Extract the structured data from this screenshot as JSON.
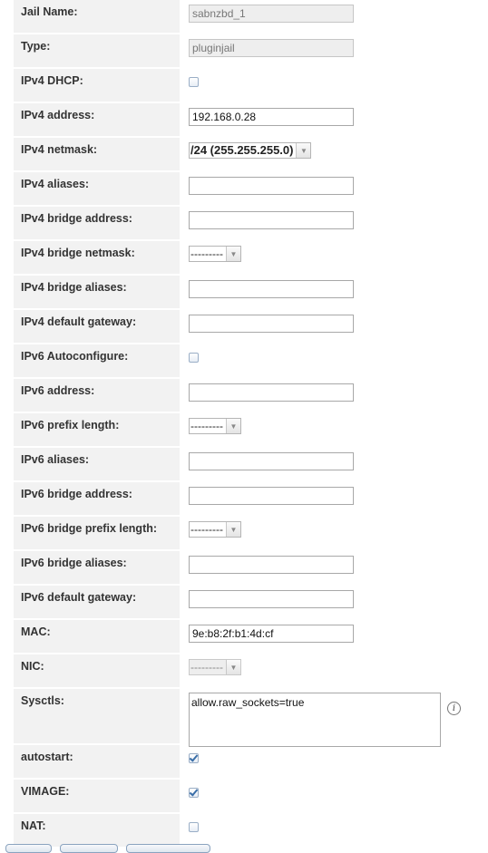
{
  "form": {
    "jail_name_label": "Jail Name:",
    "jail_name_value": "sabnzbd_1",
    "type_label": "Type:",
    "type_value": "pluginjail",
    "ipv4_dhcp_label": "IPv4 DHCP:",
    "ipv4_dhcp_checked": false,
    "ipv4_address_label": "IPv4 address:",
    "ipv4_address_value": "192.168.0.28",
    "ipv4_netmask_label": "IPv4 netmask:",
    "ipv4_netmask_value": "/24 (255.255.255.0)",
    "ipv4_aliases_label": "IPv4 aliases:",
    "ipv4_aliases_value": "",
    "ipv4_bridge_address_label": "IPv4 bridge address:",
    "ipv4_bridge_address_value": "",
    "ipv4_bridge_netmask_label": "IPv4 bridge netmask:",
    "ipv4_bridge_netmask_value": "---------",
    "ipv4_bridge_aliases_label": "IPv4 bridge aliases:",
    "ipv4_bridge_aliases_value": "",
    "ipv4_default_gateway_label": "IPv4 default gateway:",
    "ipv4_default_gateway_value": "",
    "ipv6_autoconfigure_label": "IPv6 Autoconfigure:",
    "ipv6_autoconfigure_checked": false,
    "ipv6_address_label": "IPv6 address:",
    "ipv6_address_value": "",
    "ipv6_prefix_length_label": "IPv6 prefix length:",
    "ipv6_prefix_length_value": "---------",
    "ipv6_aliases_label": "IPv6 aliases:",
    "ipv6_aliases_value": "",
    "ipv6_bridge_address_label": "IPv6 bridge address:",
    "ipv6_bridge_address_value": "",
    "ipv6_bridge_prefix_length_label": "IPv6 bridge prefix length:",
    "ipv6_bridge_prefix_length_value": "---------",
    "ipv6_bridge_aliases_label": "IPv6 bridge aliases:",
    "ipv6_bridge_aliases_value": "",
    "ipv6_default_gateway_label": "IPv6 default gateway:",
    "ipv6_default_gateway_value": "",
    "mac_label": "MAC:",
    "mac_value": "9e:b8:2f:b1:4d:cf",
    "nic_label": "NIC:",
    "nic_value": "---------",
    "sysctls_label": "Sysctls:",
    "sysctls_value": "allow.raw_sockets=true",
    "autostart_label": "autostart:",
    "autostart_checked": true,
    "vimage_label": "VIMAGE:",
    "vimage_checked": true,
    "nat_label": "NAT:",
    "nat_checked": false
  },
  "icons": {
    "info": "info-icon",
    "info_glyph": "i",
    "dropdown_arrow": "chevron-down-icon"
  },
  "colors": {
    "label_background": "#f2f2f2",
    "checkbox_check": "#3a6ea8"
  }
}
